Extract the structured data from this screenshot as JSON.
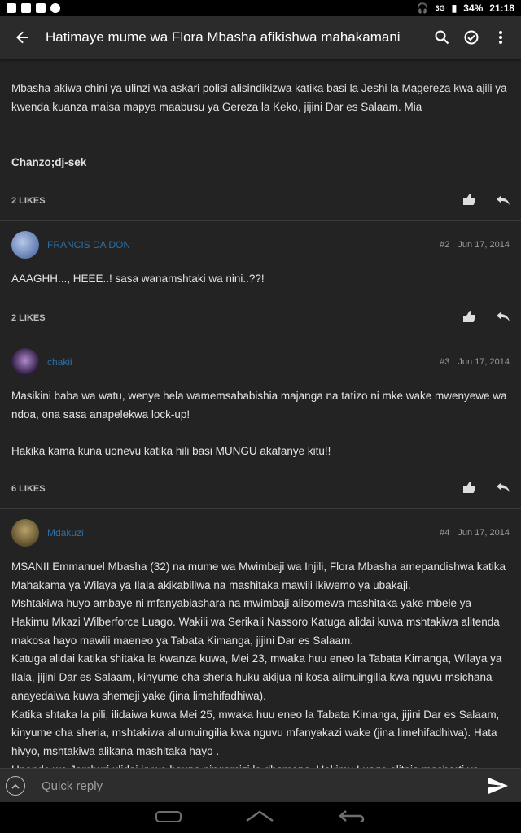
{
  "statusbar": {
    "battery": "34%",
    "time": "21:18",
    "signal": "3G"
  },
  "appbar": {
    "title": "Hatimaye mume wa Flora Mbasha afikishwa mahakamani"
  },
  "posts": [
    {
      "paragraphs": [
        "Mbasha akiwa chini ya ulinzi wa askari polisi alisindikizwa katika basi la Jeshi la Magereza kwa ajili ya kwenda kuanza maisa mapya maabusu ya Gereza la Keko, jijini Dar es Salaam. Mia",
        "",
        "Chanzo;dj-sek"
      ],
      "likes": "2 LIKES"
    },
    {
      "author": "FRANCIS DA DON",
      "number": "#2",
      "date": "Jun 17, 2014",
      "paragraphs": [
        "AAAGHH..., HEEE..! sasa wanamshtaki wa nini..??!"
      ],
      "likes": "2 LIKES"
    },
    {
      "author": "chakii",
      "number": "#3",
      "date": "Jun 17, 2014",
      "paragraphs": [
        "Masikini baba wa watu, wenye hela wamemsababishia majanga na tatizo ni mke wake mwenyewe wa ndoa, ona sasa anapelekwa lock-up!",
        "",
        "Hakika kama kuna uonevu katika hili basi MUNGU akafanye kitu!!"
      ],
      "likes": "6 LIKES"
    },
    {
      "author": "Mdakuzi",
      "number": "#4",
      "date": "Jun 17, 2014",
      "paragraphs": [
        "MSANII Emmanuel Mbasha (32) na mume wa Mwimbaji wa Injili, Flora Mbasha amepandishwa katika Mahakama ya Wilaya ya Ilala akikabiliwa na mashitaka mawili ikiwemo ya ubakaji.",
        "Mshtakiwa huyo ambaye ni mfanyabiashara na mwimbaji alisomewa mashitaka yake mbele ya Hakimu Mkazi Wilberforce Luago. Wakili wa Serikali Nassoro Katuga alidai kuwa mshtakiwa alitenda makosa hayo mawili maeneo ya Tabata Kimanga, jijini Dar es Salaam.",
        "Katuga alidai katika shitaka la kwanza kuwa, Mei 23, mwaka huu eneo la Tabata Kimanga, Wilaya ya Ilala, jijini Dar es Salaam, kinyume cha sheria huku akijua ni kosa alimuingilia kwa nguvu msichana anayedaiwa kuwa shemeji yake (jina limehifadhiwa).",
        "Katika shtaka la pili, ilidaiwa kuwa Mei 25, mwaka huu eneo la Tabata Kimanga, jijini Dar es Salaam, kinyume cha sheria, mshtakiwa aliumuingilia kwa nguvu mfanyakazi wake (jina limehifadhiwa). Hata hivyo, mshtakiwa alikana mashitaka hayo .",
        "Upande wa Jamhuri ulidai kuwa hauna pingamizi la dhamana. Hakimu Luago alitaja masharti ya dhamana kwa mshtakiwa kuwa na wadhamini wawili, mmoja awe mtumishi wa serikali na mwingine kutoka taasisi inayotambulika watakaosaini hati ya dhamana ya Sh. milioni 5."
      ]
    }
  ],
  "quick_reply": {
    "placeholder": "Quick reply"
  },
  "colors": {
    "author": "#2c6fa5",
    "background": "#232323",
    "appbar": "#2b2b2b"
  }
}
